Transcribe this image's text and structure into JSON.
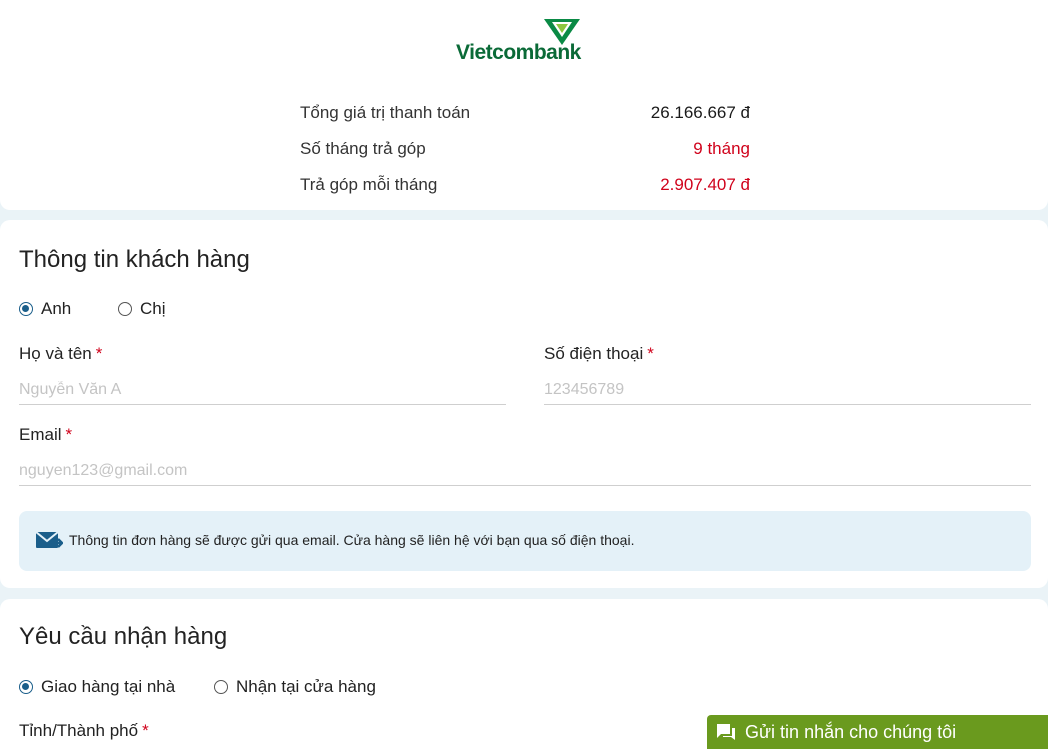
{
  "brand": {
    "name": "Vietcombank"
  },
  "summary": {
    "total_label": "Tổng giá trị thanh toán",
    "total_value": "26.166.667 đ",
    "months_label": "Số tháng trả góp",
    "months_value": "9 tháng",
    "monthly_label": "Trả góp mỗi tháng",
    "monthly_value": "2.907.407 đ"
  },
  "customer": {
    "title": "Thông tin khách hàng",
    "salutation_options": [
      "Anh",
      "Chị"
    ],
    "salutation_selected": "Anh",
    "name_label": "Họ và tên",
    "name_placeholder": "Nguyễn Văn A",
    "phone_label": "Số điện thoại",
    "phone_placeholder": "123456789",
    "email_label": "Email",
    "email_placeholder": "nguyen123@gmail.com",
    "required_mark": "*",
    "notice": "Thông tin đơn hàng sẽ được gửi qua email. Cửa hàng sẽ liên hệ với bạn qua số điện thoại."
  },
  "delivery": {
    "title": "Yêu cầu nhận hàng",
    "options": [
      "Giao hàng tại nhà",
      "Nhận tại cửa hàng"
    ],
    "selected": "Giao hàng tại nhà",
    "province_label": "Tỉnh/Thành phố"
  },
  "chat": {
    "label": "Gửi tin nhắn cho chúng tôi",
    "icon": "chat-icon"
  },
  "colors": {
    "brand_green": "#0a6a37",
    "accent_red": "#d0021b",
    "radio_blue": "#1a5e8a",
    "chat_green": "#6a9a1e",
    "page_bg": "#eaf3f7"
  }
}
